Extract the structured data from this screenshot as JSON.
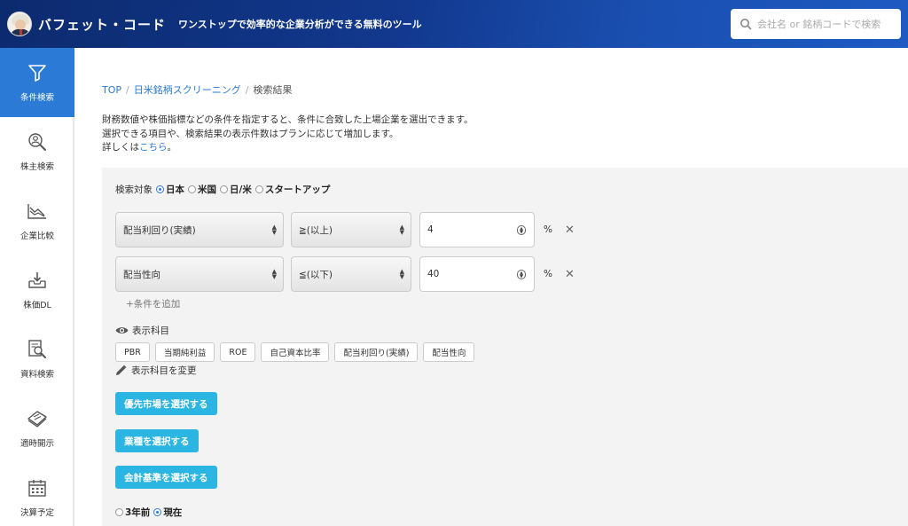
{
  "header": {
    "brand": "バフェット・コード",
    "tagline": "ワンストップで効率的な企業分析ができる無料のツール",
    "search_placeholder": "会社名 or 銘柄コードで検索"
  },
  "sidebar": {
    "items": [
      {
        "label": "条件検索",
        "icon": "filter-icon",
        "active": true
      },
      {
        "label": "株主検索",
        "icon": "person-search-icon",
        "active": false
      },
      {
        "label": "企業比較",
        "icon": "chart-compare-icon",
        "active": false
      },
      {
        "label": "株価DL",
        "icon": "download-tray-icon",
        "active": false
      },
      {
        "label": "資料検索",
        "icon": "document-search-icon",
        "active": false
      },
      {
        "label": "適時開示",
        "icon": "newspaper-icon",
        "active": false
      },
      {
        "label": "決算予定",
        "icon": "calendar-icon",
        "active": false
      }
    ]
  },
  "breadcrumb": {
    "top": "TOP",
    "screening": "日米銘柄スクリーニング",
    "current": "検索結果"
  },
  "description": {
    "line1": "財務数値や株価指標などの条件を指定すると、条件に合致した上場企業を選出できます。",
    "line2": "選択できる項目や、検索結果の表示件数はプランに応じて増加します。",
    "line3_prefix": "詳しくは",
    "line3_link": "こちら",
    "line3_suffix": "。"
  },
  "search_target": {
    "label": "検索対象",
    "options": [
      "日本",
      "米国",
      "日/米",
      "スタートアップ"
    ],
    "selected": "日本"
  },
  "conditions": [
    {
      "field": "配当利回り(実績)",
      "operator": "≧(以上)",
      "value": "4",
      "unit": "%"
    },
    {
      "field": "配当性向",
      "operator": "≦(以下)",
      "value": "40",
      "unit": "%"
    }
  ],
  "remove_symbol": "✕",
  "add_condition_label": "+条件を追加",
  "display_items": {
    "heading": "表示科目",
    "chips": [
      "PBR",
      "当期純利益",
      "ROE",
      "自己資本比率",
      "配当利回り(実績)",
      "配当性向"
    ],
    "edit_label": "表示科目を変更"
  },
  "buttons": {
    "market": "優先市場を選択する",
    "industry": "業種を選択する",
    "accounting": "会計基準を選択する"
  },
  "period": {
    "options": [
      "3年前",
      "現在"
    ],
    "selected": "現在"
  },
  "colors": {
    "header_bg": "#12398f",
    "active_nav": "#2a7ad6",
    "link": "#2a7ad6",
    "button": "#2bb5e3"
  }
}
